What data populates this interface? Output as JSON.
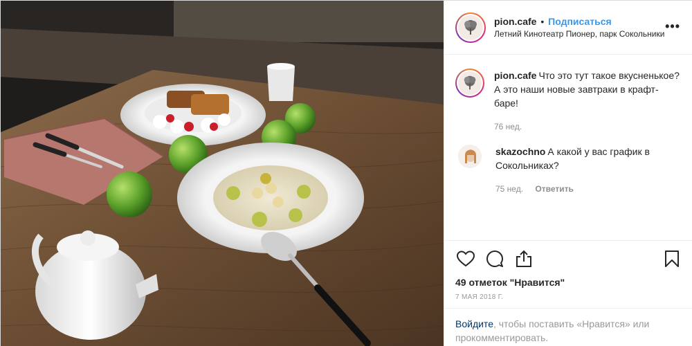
{
  "header": {
    "username": "pion.cafe",
    "separator": "•",
    "follow_label": "Подписаться",
    "location": "Летний Кинотеатр Пионер, парк Сокольники",
    "more_label": "•••"
  },
  "comments": [
    {
      "username": "pion.cafe",
      "text": "Что это тут такое вкусненькое? А это наши новые завтраки в крафт-баре!",
      "time": "76 нед."
    },
    {
      "username": "skazochno",
      "text": "А какой у вас график в Сокольниках?",
      "time": "75 нед.",
      "reply_label": "Ответить"
    }
  ],
  "actions": {
    "like_icon": "heart-icon",
    "comment_icon": "comment-icon",
    "share_icon": "share-icon",
    "save_icon": "bookmark-icon"
  },
  "likes": "49 отметок \"Нравится\"",
  "date": "7 МАЯ 2018 Г.",
  "login": {
    "link": "Войдите",
    "rest": ", чтобы поставить «Нравится» или прокомментировать."
  },
  "colors": {
    "link_blue": "#3897f0",
    "dark_link": "#003569",
    "muted": "#8e8e8e"
  }
}
